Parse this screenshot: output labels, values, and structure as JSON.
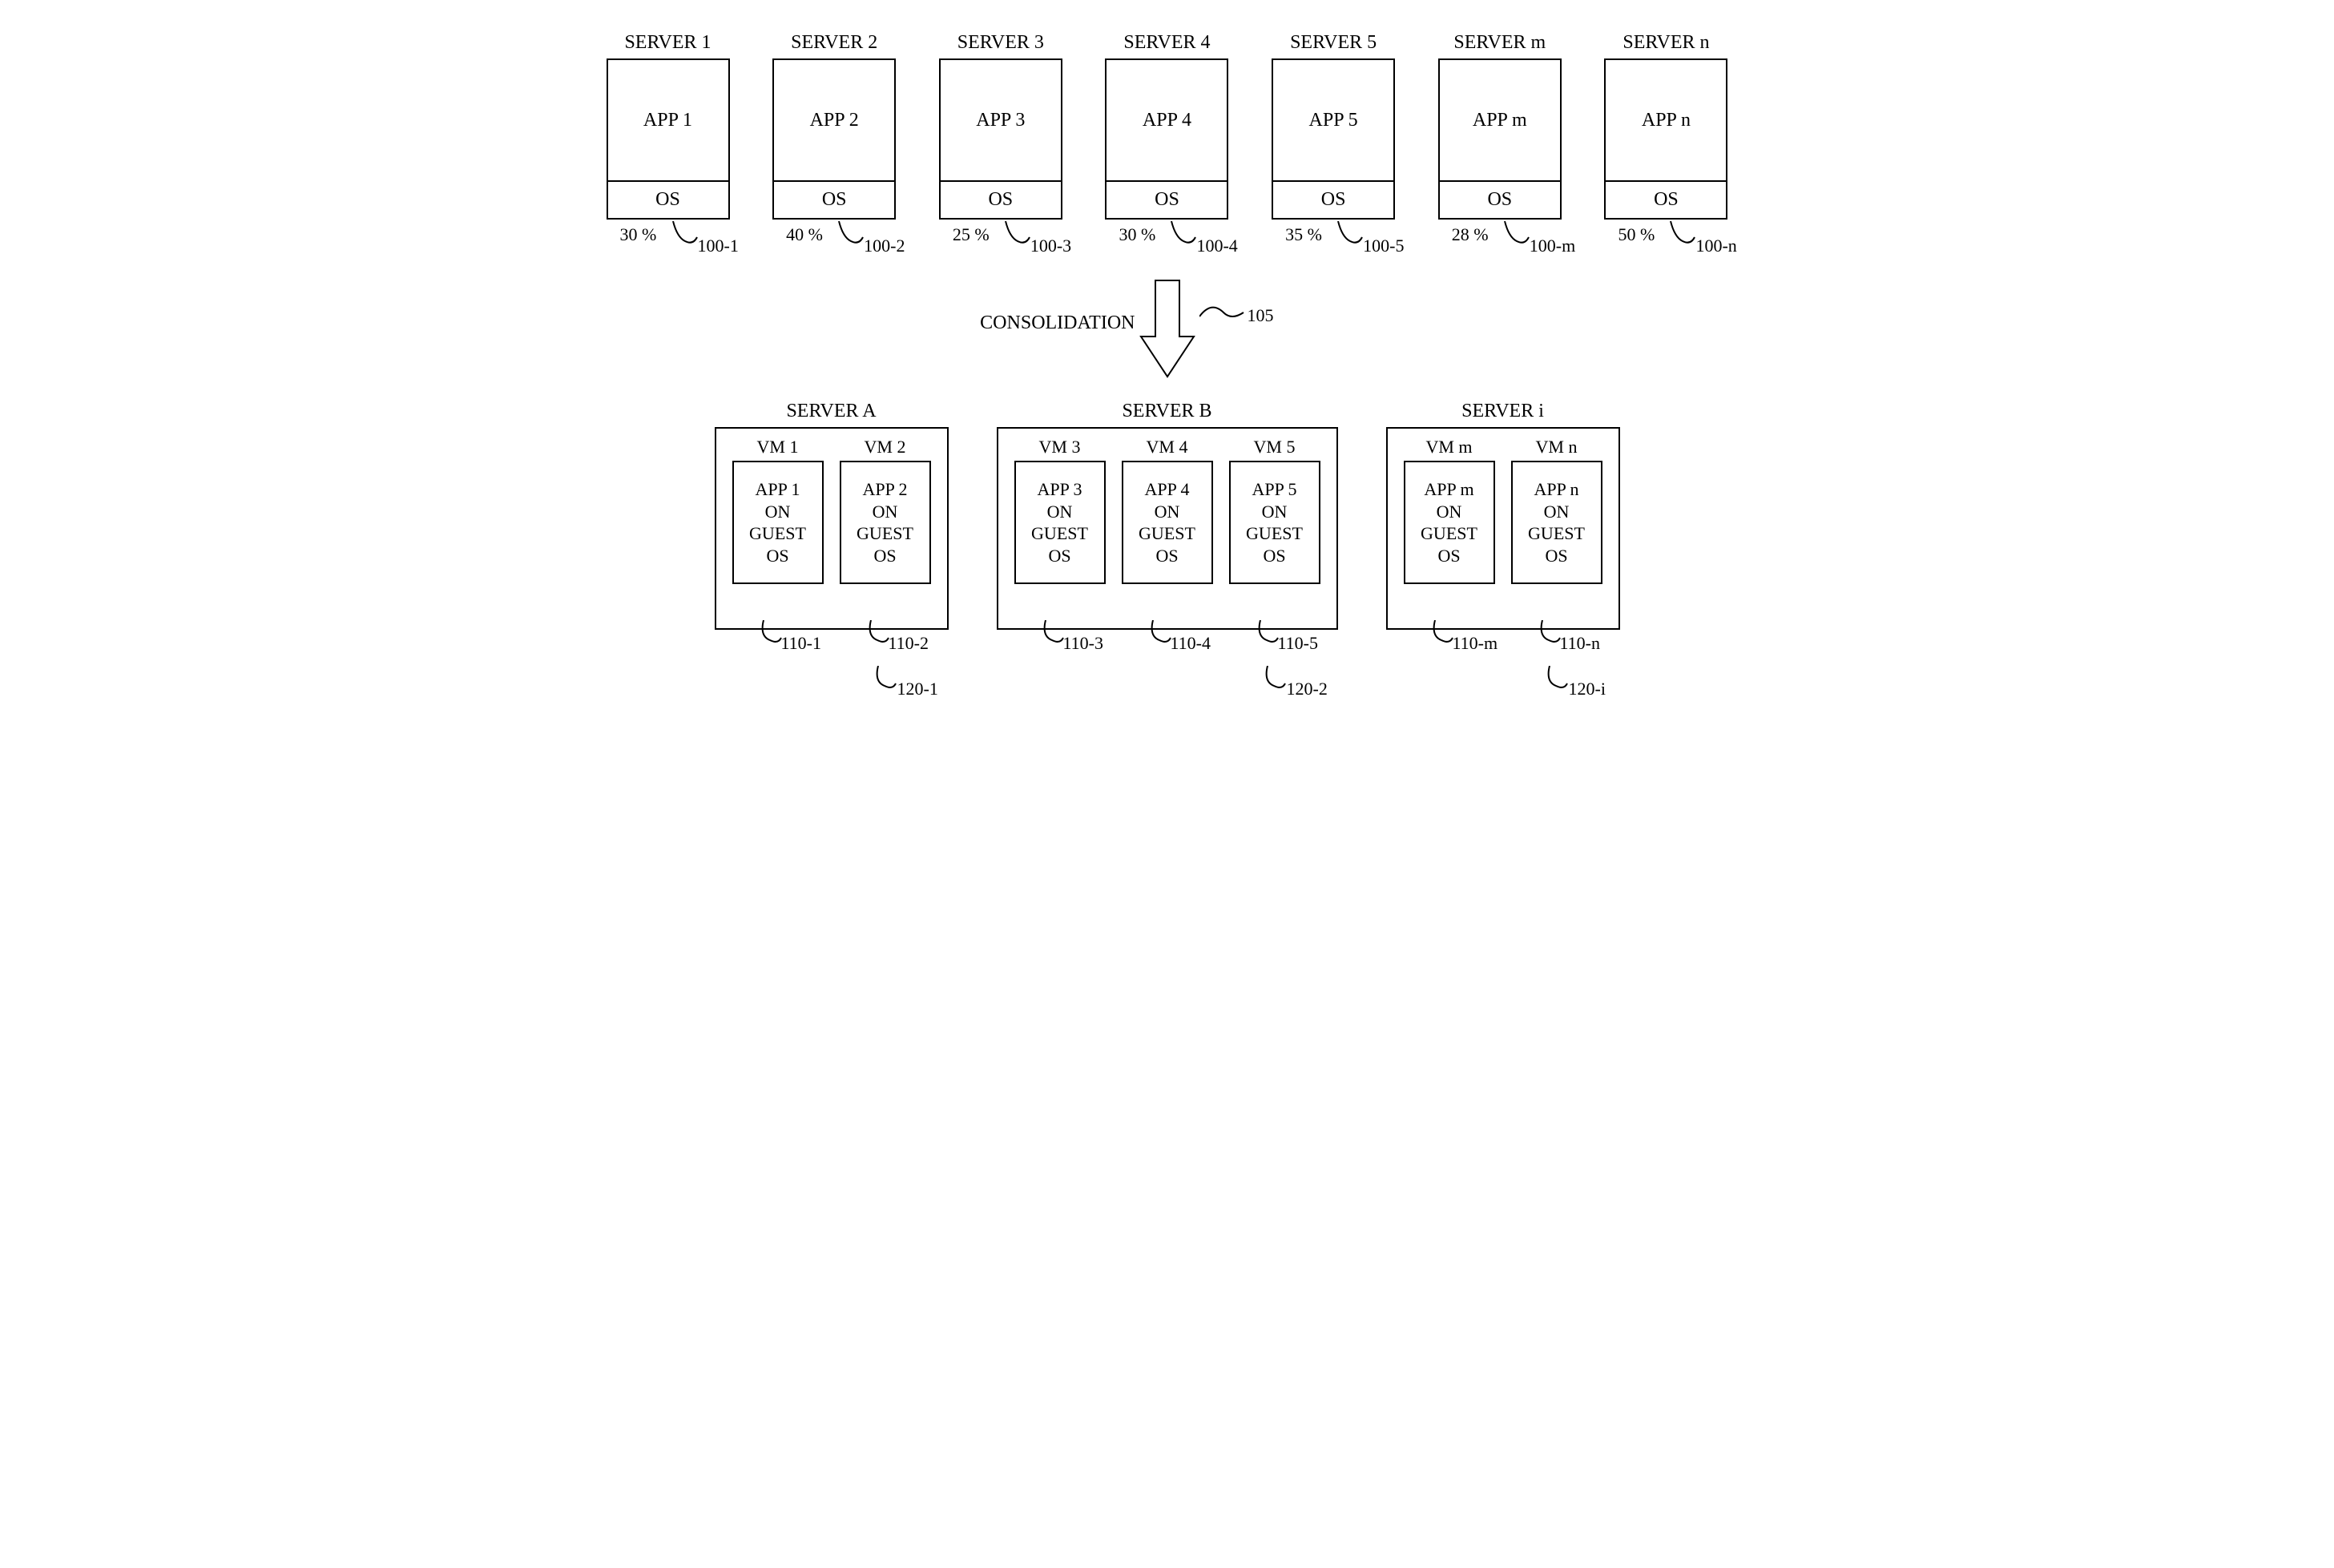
{
  "top_servers": [
    {
      "title": "SERVER 1",
      "app": "APP 1",
      "os": "OS",
      "pct": "30 %",
      "ref": "100-1"
    },
    {
      "title": "SERVER 2",
      "app": "APP 2",
      "os": "OS",
      "pct": "40 %",
      "ref": "100-2"
    },
    {
      "title": "SERVER 3",
      "app": "APP 3",
      "os": "OS",
      "pct": "25 %",
      "ref": "100-3"
    },
    {
      "title": "SERVER 4",
      "app": "APP 4",
      "os": "OS",
      "pct": "30 %",
      "ref": "100-4"
    },
    {
      "title": "SERVER 5",
      "app": "APP 5",
      "os": "OS",
      "pct": "35 %",
      "ref": "100-5"
    },
    {
      "title": "SERVER m",
      "app": "APP m",
      "os": "OS",
      "pct": "28 %",
      "ref": "100-m"
    },
    {
      "title": "SERVER n",
      "app": "APP n",
      "os": "OS",
      "pct": "50 %",
      "ref": "100-n"
    }
  ],
  "arrow": {
    "label": "CONSOLIDATION",
    "ref": "105"
  },
  "hosts": [
    {
      "title": "SERVER A",
      "ref": "120-1",
      "vms": [
        {
          "title": "VM 1",
          "l1": "APP 1",
          "l2": "ON",
          "l3": "GUEST",
          "l4": "OS",
          "ref": "110-1"
        },
        {
          "title": "VM 2",
          "l1": "APP 2",
          "l2": "ON",
          "l3": "GUEST",
          "l4": "OS",
          "ref": "110-2"
        }
      ]
    },
    {
      "title": "SERVER B",
      "ref": "120-2",
      "vms": [
        {
          "title": "VM 3",
          "l1": "APP 3",
          "l2": "ON",
          "l3": "GUEST",
          "l4": "OS",
          "ref": "110-3"
        },
        {
          "title": "VM 4",
          "l1": "APP 4",
          "l2": "ON",
          "l3": "GUEST",
          "l4": "OS",
          "ref": "110-4"
        },
        {
          "title": "VM 5",
          "l1": "APP 5",
          "l2": "ON",
          "l3": "GUEST",
          "l4": "OS",
          "ref": "110-5"
        }
      ]
    },
    {
      "title": "SERVER i",
      "ref": "120-i",
      "vms": [
        {
          "title": "VM m",
          "l1": "APP m",
          "l2": "ON",
          "l3": "GUEST",
          "l4": "OS",
          "ref": "110-m"
        },
        {
          "title": "VM n",
          "l1": "APP n",
          "l2": "ON",
          "l3": "GUEST",
          "l4": "OS",
          "ref": "110-n"
        }
      ]
    }
  ]
}
